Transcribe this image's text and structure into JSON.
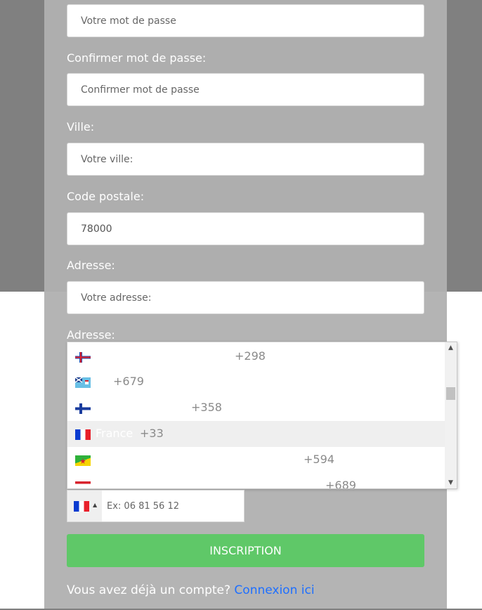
{
  "form": {
    "password_placeholder": "Votre mot de passe",
    "confirm_label": "Confirmer mot de passe:",
    "confirm_placeholder": "Confirmer mot de passe",
    "city_label": "Ville:",
    "city_placeholder": "Votre ville:",
    "zip_label": "Code postale:",
    "zip_value": "78000",
    "address_label": "Adresse:",
    "address_placeholder": "Votre adresse:",
    "phone_label": "Adresse:",
    "phone_placeholder": "Ex: 06 81 56 12",
    "submit_label": "INSCRIPTION",
    "footer_text": "Vous avez déjà un compte?",
    "footer_link": "Connexion ici"
  },
  "country_list": {
    "items": [
      {
        "flag_icon": "faroe-islands-flag-icon",
        "name": "",
        "dial_code": "+298"
      },
      {
        "flag_icon": "fiji-flag-icon",
        "name": "",
        "dial_code": "+679"
      },
      {
        "flag_icon": "finland-flag-icon",
        "name": "",
        "dial_code": "+358"
      },
      {
        "flag_icon": "france-flag-icon",
        "name": "France",
        "dial_code": "+33",
        "highlighted": true
      },
      {
        "flag_icon": "french-guiana-flag-icon",
        "name": "",
        "dial_code": "+594"
      },
      {
        "flag_icon": "french-polynesia-flag-icon",
        "name": "",
        "dial_code": "+689"
      }
    ],
    "selected_flag_icon": "france-flag-icon"
  },
  "colors": {
    "page_background": "#808080",
    "card_background": "#b4b4b4",
    "submit_button": "#5fc868",
    "link": "#1e6fff"
  }
}
